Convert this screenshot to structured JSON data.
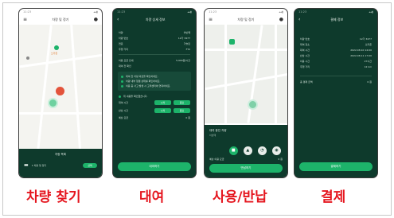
{
  "phones": {
    "p1": {
      "status_time": "11:23",
      "status_icons": "▴▴▮",
      "title": "차량 및 정기",
      "pin_label": "쏘카존",
      "sheet_title": "차량 목록",
      "car_desc": "1 차량 및 정기",
      "select_label": "선택"
    },
    "p2": {
      "status_time": "11:23",
      "status_icons": "▴▴▮",
      "title": "차량 상세 정보",
      "rows": [
        {
          "k": "차량",
          "v": "아반떼"
        },
        {
          "k": "차량 번호",
          "v": "12가 3477"
        },
        {
          "k": "연료",
          "v": "가솔린"
        },
        {
          "k": "주행 거리",
          "v": "FT2"
        }
      ],
      "fee_label": "이용 요금 안내",
      "fee_value": "5,900원/시간",
      "notice_title": "대여 전 확인",
      "bullets": [
        "대여 전 차량 외관을 확인하세요.",
        "차량 내부 청결 상태를 확인하세요.",
        "이용 중 사고 발생 시 고객센터에 연락하세요."
      ],
      "agree_label": "위 내용을 확인했습니다.",
      "rent_label": "대여 시간",
      "return_label": "반납 시간",
      "slot_a": "시작",
      "slot_b": "종료",
      "total_label": "예상 요금",
      "total_value": "0 원",
      "button": "대여하기"
    },
    "p3": {
      "status_time": "11:23",
      "status_icons": "▴▴▮",
      "title": "차량 및 정기",
      "sheet_title": "대여 중인 차량",
      "sheet_sub": "아반떼",
      "action_icons": [
        "car-icon",
        "lock-icon",
        "unlock-icon",
        "horn-icon"
      ],
      "fee_label": "예상 이용 요금",
      "fee_value": "0 원",
      "button": "반납하기"
    },
    "p4": {
      "status_time": "11:23",
      "status_icons": "▴▴▮",
      "title": "결제 정보",
      "rows": [
        {
          "k": "차량 번호",
          "v": "12가 3477"
        },
        {
          "k": "대여 장소",
          "v": "쏘카존"
        },
        {
          "k": "대여 시간",
          "v": "2022.08.10 14:00"
        },
        {
          "k": "반납 시간",
          "v": "2022.08.11 17:00"
        },
        {
          "k": "이용 시간",
          "v": "27시간"
        },
        {
          "k": "주행 거리",
          "v": "12 km"
        }
      ],
      "total_label": "총 결제 금액",
      "total_value": "0 원",
      "button": "결제하기"
    }
  },
  "captions": {
    "find": "차량 찾기",
    "rent": "대여",
    "use_return": "사용/반납",
    "pay": "결제"
  },
  "colors": {
    "brand_dark": "#0e3a2c",
    "brand_accent": "#1db36a",
    "caption_red": "#e5161f"
  }
}
